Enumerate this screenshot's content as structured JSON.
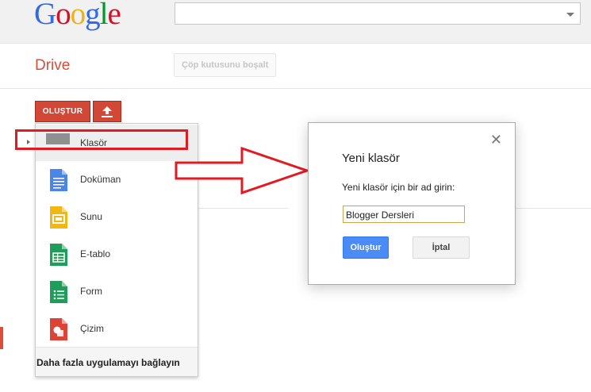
{
  "header": {
    "logo_letters": [
      "G",
      "o",
      "o",
      "g",
      "l",
      "e"
    ],
    "logo_colors": [
      "#3369e8",
      "#d50f25",
      "#eeb211",
      "#3369e8",
      "#009925",
      "#d50f25"
    ],
    "search_value": ""
  },
  "drive": {
    "title": "Drive",
    "empty_trash_label": "Çöp kutusunu boşalt"
  },
  "toolbar": {
    "create_label": "OLUŞTUR",
    "upload_icon": "upload-icon"
  },
  "menu": {
    "items": [
      {
        "label": "Klasör",
        "icon": "folder-icon",
        "color": "#8f8f8f"
      },
      {
        "label": "Doküman",
        "icon": "document-icon",
        "color": "#4a86e8"
      },
      {
        "label": "Sunu",
        "icon": "presentation-icon",
        "color": "#f1b713"
      },
      {
        "label": "E-tablo",
        "icon": "spreadsheet-icon",
        "color": "#1e9e5a"
      },
      {
        "label": "Form",
        "icon": "form-icon",
        "color": "#1e9e5a"
      },
      {
        "label": "Çizim",
        "icon": "drawing-icon",
        "color": "#db4437"
      }
    ],
    "footer_label": "Daha fazla uygulamayı bağlayın"
  },
  "dialog": {
    "title": "Yeni klasör",
    "prompt": "Yeni klasör için bir ad girin:",
    "input_value": "Blogger Dersleri",
    "ok_label": "Oluştur",
    "cancel_label": "İptal",
    "close_icon": "close-icon"
  },
  "annotation": {
    "color": "#e21a22"
  }
}
